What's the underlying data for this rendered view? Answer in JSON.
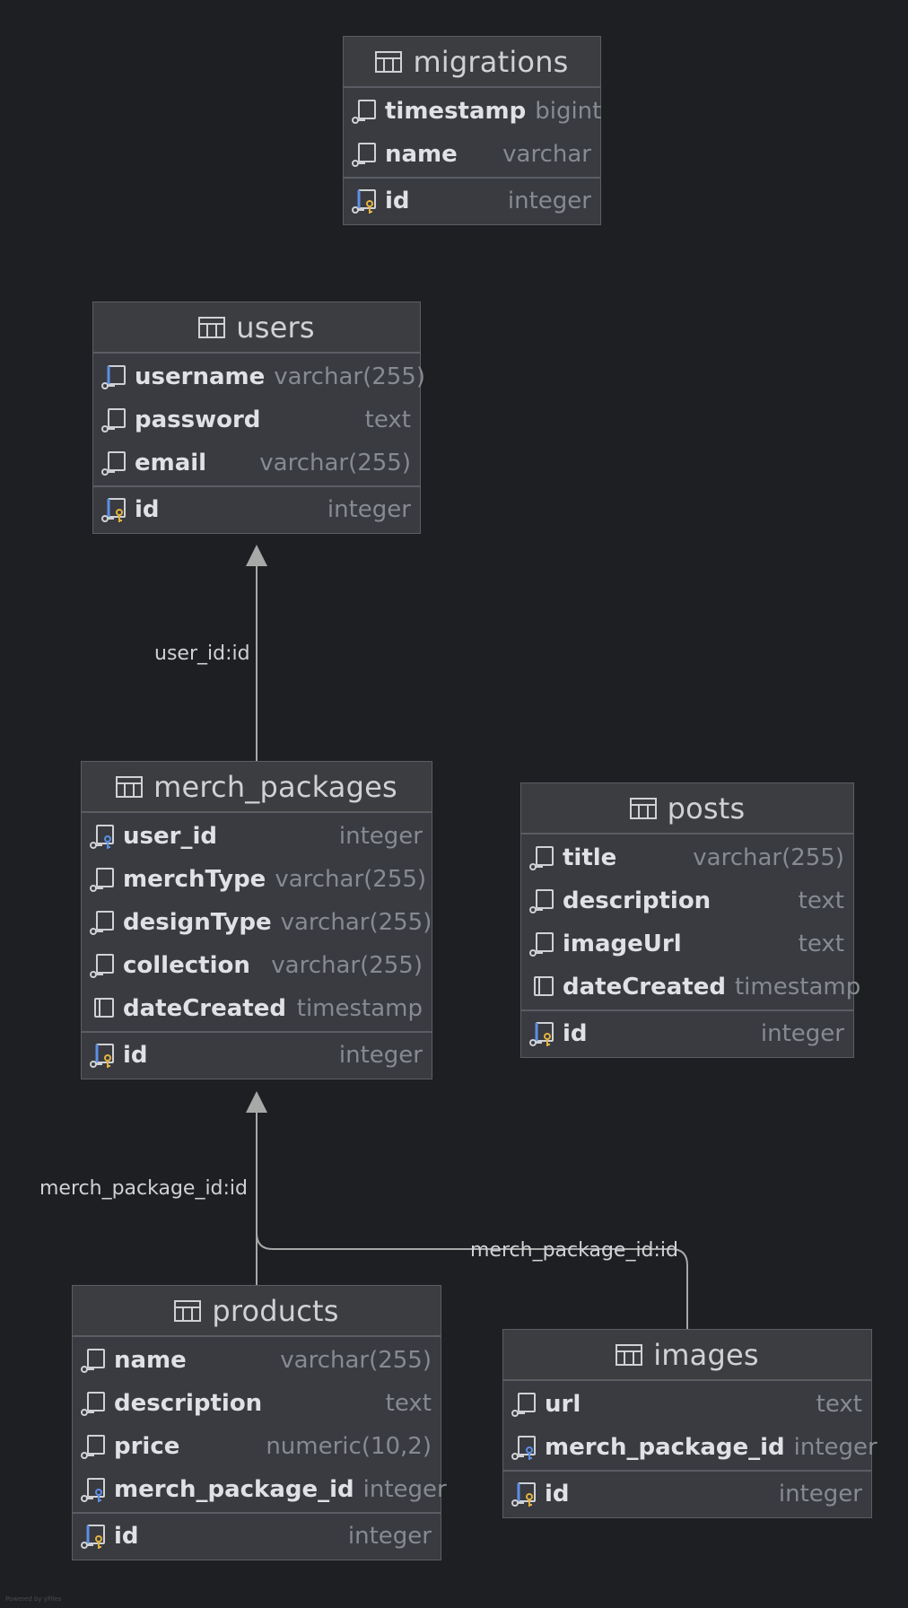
{
  "tables": {
    "migrations": {
      "name": "migrations",
      "columns": [
        {
          "name": "timestamp",
          "type": "bigint",
          "kind": "column"
        },
        {
          "name": "name",
          "type": "varchar",
          "kind": "column"
        }
      ],
      "pk": {
        "name": "id",
        "type": "integer"
      }
    },
    "users": {
      "name": "users",
      "columns": [
        {
          "name": "username",
          "type": "varchar(255)",
          "kind": "index"
        },
        {
          "name": "password",
          "type": "text",
          "kind": "column"
        },
        {
          "name": "email",
          "type": "varchar(255)",
          "kind": "column"
        }
      ],
      "pk": {
        "name": "id",
        "type": "integer"
      }
    },
    "merch_packages": {
      "name": "merch_packages",
      "columns": [
        {
          "name": "user_id",
          "type": "integer",
          "kind": "fk"
        },
        {
          "name": "merchType",
          "type": "varchar(255)",
          "kind": "column"
        },
        {
          "name": "designType",
          "type": "varchar(255)",
          "kind": "column"
        },
        {
          "name": "collection",
          "type": "varchar(255)",
          "kind": "column"
        },
        {
          "name": "dateCreated",
          "type": "timestamp",
          "kind": "nullable"
        }
      ],
      "pk": {
        "name": "id",
        "type": "integer"
      }
    },
    "posts": {
      "name": "posts",
      "columns": [
        {
          "name": "title",
          "type": "varchar(255)",
          "kind": "column"
        },
        {
          "name": "description",
          "type": "text",
          "kind": "column"
        },
        {
          "name": "imageUrl",
          "type": "text",
          "kind": "column"
        },
        {
          "name": "dateCreated",
          "type": "timestamp",
          "kind": "nullable"
        }
      ],
      "pk": {
        "name": "id",
        "type": "integer"
      }
    },
    "products": {
      "name": "products",
      "columns": [
        {
          "name": "name",
          "type": "varchar(255)",
          "kind": "column"
        },
        {
          "name": "description",
          "type": "text",
          "kind": "column"
        },
        {
          "name": "price",
          "type": "numeric(10,2)",
          "kind": "column"
        },
        {
          "name": "merch_package_id",
          "type": "integer",
          "kind": "fk"
        }
      ],
      "pk": {
        "name": "id",
        "type": "integer"
      }
    },
    "images": {
      "name": "images",
      "columns": [
        {
          "name": "url",
          "type": "text",
          "kind": "column"
        },
        {
          "name": "merch_package_id",
          "type": "integer",
          "kind": "fk"
        }
      ],
      "pk": {
        "name": "id",
        "type": "integer"
      }
    }
  },
  "relations": [
    {
      "label": "user_id:id",
      "from": "merch_packages",
      "to": "users"
    },
    {
      "label": "merch_package_id:id",
      "from": "products",
      "to": "merch_packages"
    },
    {
      "label": "merch_package_id:id",
      "from": "images",
      "to": "merch_packages"
    }
  ],
  "footer": "Powered by yFiles",
  "colors": {
    "background": "#1e1f22",
    "table_body": "#393b40",
    "table_header": "#3c3d40",
    "border": "#5a5d63",
    "connector": "#a8a8a8",
    "key_gold": "#e2b340",
    "index_blue": "#5c8fe6"
  }
}
